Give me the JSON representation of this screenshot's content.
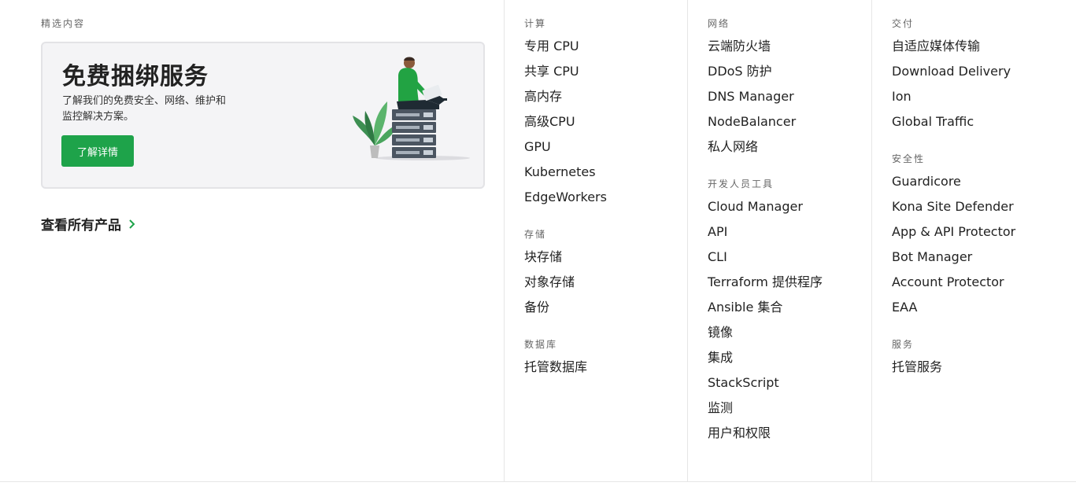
{
  "featured": {
    "section_label": "精选内容",
    "promo": {
      "title": "免费捆绑服务",
      "description": "了解我们的免费安全、网络、维护和监控解决方案。",
      "button_label": "了解详情"
    },
    "all_products_label": "查看所有产品"
  },
  "colors": {
    "accent": "#1ea34a",
    "text": "#222222",
    "muted": "#666666",
    "divider": "#e6e6e6"
  },
  "columns": [
    {
      "groups": [
        {
          "label": "计算",
          "items": [
            "专用 CPU",
            "共享 CPU",
            "高内存",
            "高级CPU",
            "GPU",
            "Kubernetes",
            "EdgeWorkers"
          ]
        },
        {
          "label": "存储",
          "items": [
            "块存储",
            "对象存储",
            "备份"
          ]
        },
        {
          "label": "数据库",
          "items": [
            "托管数据库"
          ]
        }
      ]
    },
    {
      "groups": [
        {
          "label": "网络",
          "items": [
            "云端防火墙",
            "DDoS 防护",
            "DNS Manager",
            "NodeBalancer",
            "私人网络"
          ]
        },
        {
          "label": "开发人员工具",
          "items": [
            "Cloud Manager",
            "API",
            "CLI",
            "Terraform 提供程序",
            "Ansible 集合",
            "镜像",
            "集成",
            "StackScript",
            "监测",
            "用户和权限"
          ]
        }
      ]
    },
    {
      "groups": [
        {
          "label": "交付",
          "items": [
            "自适应媒体传输",
            "Download Delivery",
            "Ion",
            "Global Traffic"
          ]
        },
        {
          "label": "安全性",
          "items": [
            "Guardicore",
            "Kona Site Defender",
            "App & API Protector",
            "Bot Manager",
            "Account Protector",
            "EAA"
          ]
        },
        {
          "label": "服务",
          "items": [
            "托管服务"
          ]
        }
      ]
    }
  ]
}
